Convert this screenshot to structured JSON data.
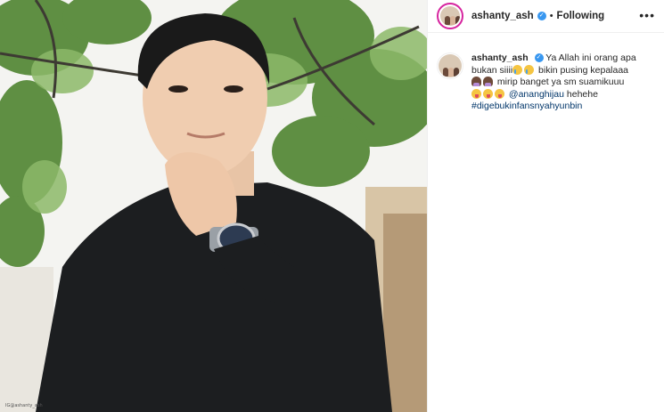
{
  "post": {
    "username": "ashanty_ash",
    "follow_status": "Following",
    "separator": "•",
    "more_label": "•••",
    "verified_mark": "✓",
    "photo_watermark": "IG@ashanty_ash",
    "caption": {
      "username": "ashanty_ash",
      "text_1": "Ya Allah ini orang apa bukan siiii",
      "text_2": "bikin pusing kepalaaa",
      "text_3": "mirip banget ya sm suamikuuu",
      "mention": "@ananghijau",
      "text_4": "hehehe",
      "hashtag": "#digebukinfansnyahyunbin"
    },
    "emoji_icons": [
      "crying-face-icon",
      "woman-icon",
      "face-with-tongue-icon"
    ]
  }
}
